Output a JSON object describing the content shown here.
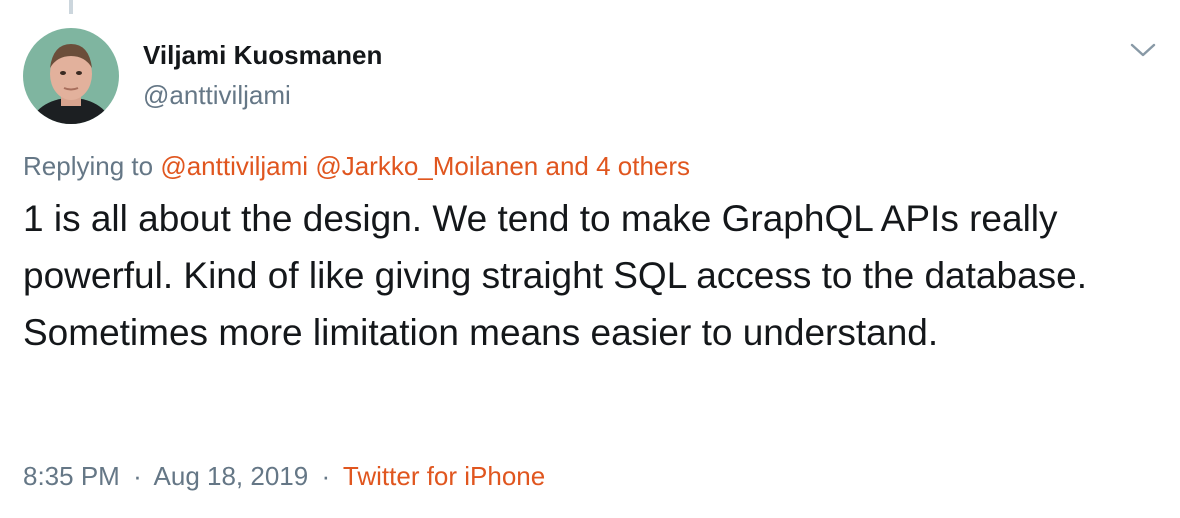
{
  "user": {
    "display_name": "Viljami Kuosmanen",
    "handle": "@anttiviljami"
  },
  "reply": {
    "prefix": "Replying to",
    "mentions": [
      "@anttiviljami",
      "@Jarkko_Moilanen",
      "and 4 others"
    ]
  },
  "tweet": {
    "text": "1 is all about the design. We tend to make GraphQL APIs really powerful. Kind of like giving straight SQL access to the database. Sometimes more limitation means easier to understand."
  },
  "meta": {
    "time": "8:35 PM",
    "separator": "·",
    "date": "Aug 18, 2019",
    "source": "Twitter for iPhone"
  },
  "icons": {
    "caret": "chevron-down-icon",
    "avatar": "avatar"
  },
  "colors": {
    "link": "#e0561f",
    "secondary_text": "#657786",
    "primary_text": "#14171a"
  }
}
